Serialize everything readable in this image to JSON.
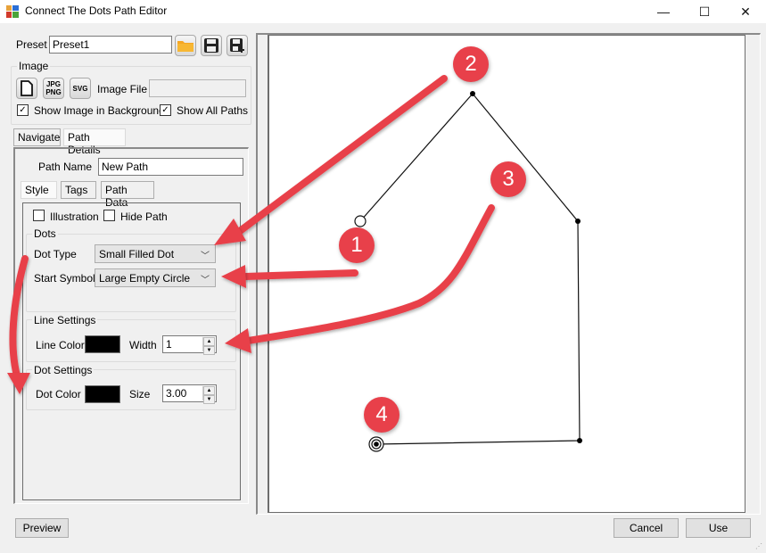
{
  "window": {
    "title": "Connect The Dots Path Editor",
    "controls": {
      "minimize": "—",
      "maximize": "☐",
      "close": "✕"
    }
  },
  "preset": {
    "label": "Preset",
    "value": "Preset1",
    "icons": [
      "open-folder-icon",
      "save-icon",
      "save-as-icon"
    ]
  },
  "image": {
    "group_title": "Image",
    "buttons": [
      {
        "name": "new-image-button",
        "label": ""
      },
      {
        "name": "jpg-png-button",
        "label_top": "JPG",
        "label_bottom": "PNG"
      },
      {
        "name": "svg-button",
        "label": "SVG"
      }
    ],
    "file_label": "Image File",
    "file_value": "",
    "show_bg_label": "Show Image in Background",
    "show_bg_checked": true,
    "show_all_label": "Show All Paths",
    "show_all_checked": true
  },
  "main_tabs": [
    {
      "label": "Navigate",
      "active": false
    },
    {
      "label": "Path Details",
      "active": true
    }
  ],
  "path": {
    "name_label": "Path Name",
    "name_value": "New Path",
    "sub_tabs": [
      {
        "label": "Style",
        "active": true
      },
      {
        "label": "Tags",
        "active": false
      },
      {
        "label": "Path Data",
        "active": false
      }
    ],
    "illustration_label": "Illustration",
    "illustration_checked": false,
    "hide_path_label": "Hide Path",
    "hide_path_checked": false,
    "dots": {
      "title": "Dots",
      "dot_type_label": "Dot Type",
      "dot_type_value": "Small Filled Dot",
      "start_symbol_label": "Start Symbol",
      "start_symbol_value": "Large Empty Circle"
    },
    "line_settings": {
      "title": "Line Settings",
      "color_label": "Line Color",
      "color": "#000000",
      "width_label": "Width",
      "width_value": "1"
    },
    "dot_settings": {
      "title": "Dot Settings",
      "color_label": "Dot Color",
      "color": "#000000",
      "size_label": "Size",
      "size_value": "3.00"
    }
  },
  "footer": {
    "preview_label": "Preview",
    "cancel_label": "Cancel",
    "use_label": "Use"
  },
  "canvas": {
    "annotations": [
      "1",
      "2",
      "3",
      "4"
    ],
    "annotation_color": "#e8404a"
  }
}
